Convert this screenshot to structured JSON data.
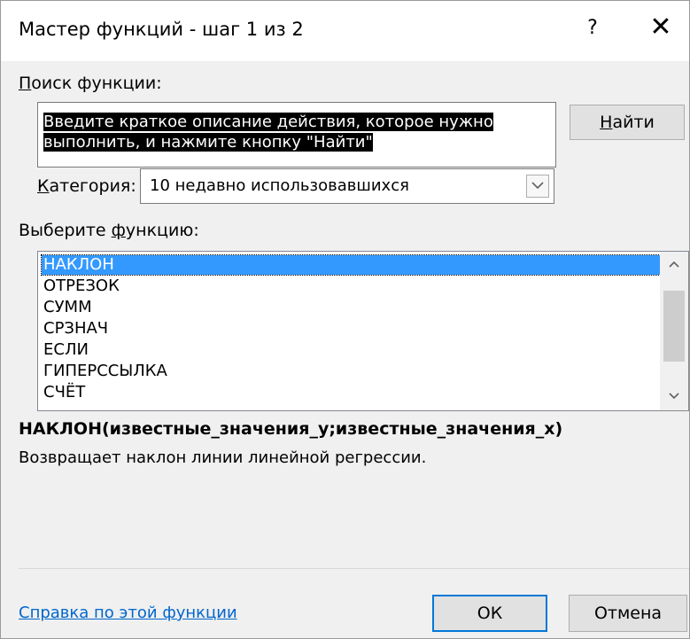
{
  "window": {
    "title": "Мастер функций - шаг 1 из 2",
    "help_symbol": "?",
    "close_symbol": "✕"
  },
  "search": {
    "label": "Поиск функции:",
    "label_hotkey": "П",
    "label_rest": "оиск функции:",
    "value": "Введите краткое описание действия, которое нужно выполнить, и нажмите кнопку \"Найти\"",
    "find_button_hotkey": "Н",
    "find_button_rest": "айти"
  },
  "category": {
    "label_hotkey": "К",
    "label_rest": "атегория:",
    "selected": "10 недавно использовавшихся"
  },
  "function_list": {
    "label_prefix": "Выберите ",
    "label_hotkey": "ф",
    "label_rest": "ункцию:",
    "items": [
      "НАКЛОН",
      "ОТРЕЗОК",
      "СУММ",
      "СРЗНАЧ",
      "ЕСЛИ",
      "ГИПЕРССЫЛКА",
      "СЧЁТ"
    ],
    "selected_index": 0
  },
  "details": {
    "signature": "НАКЛОН(известные_значения_y;известные_значения_x)",
    "description": "Возвращает наклон линии линейной регрессии."
  },
  "footer": {
    "help_link": "Справка по этой функции",
    "ok_label": "ОК",
    "cancel_label": "Отмена"
  },
  "colors": {
    "selection": "#3399ff",
    "link": "#0066cc",
    "primary_border": "#0078d7"
  }
}
